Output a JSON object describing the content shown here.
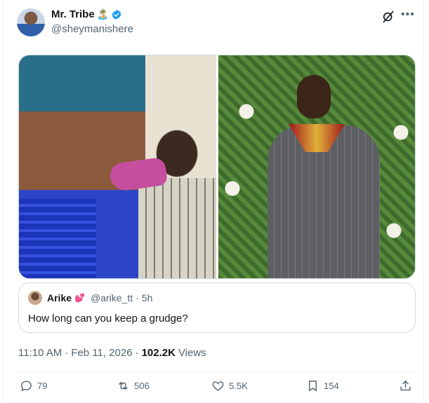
{
  "author": {
    "name": "Mr. Tribe",
    "emoji": "🏝️",
    "handle": "@sheymanishere"
  },
  "quoted": {
    "name": "Arike",
    "emoji": "💕",
    "handle": "@arike_tt",
    "time": "5h",
    "text": "How long can you keep a grudge?"
  },
  "meta": {
    "time": "11:10 AM",
    "date": "Feb 11, 2026",
    "views_count": "102.2K",
    "views_label": "Views"
  },
  "actions": {
    "replies": "79",
    "reposts": "506",
    "likes": "5.5K",
    "bookmarks": "154"
  },
  "colors": {
    "verified": "#1d9bf0",
    "text_secondary": "#536471",
    "heart": "#e0245e"
  }
}
